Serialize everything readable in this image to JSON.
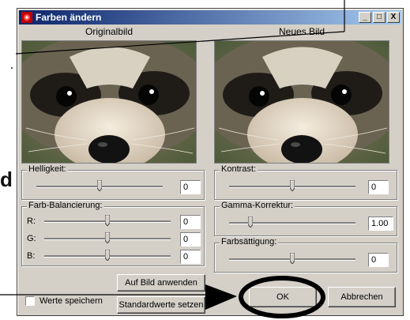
{
  "window": {
    "title": "Farben ändern",
    "controls": {
      "minimize": "_",
      "maximize": "□",
      "close": "X"
    }
  },
  "images": {
    "original_label": "Originalbild",
    "new_label": "Neues Bild"
  },
  "groups": {
    "brightness": {
      "label": "Helligkeit:",
      "value": "0",
      "level": 0.5
    },
    "contrast": {
      "label": "Kontrast:",
      "value": "0",
      "level": 0.5
    },
    "color_balance": {
      "label": "Farb-Balancierung:",
      "rows": [
        {
          "label": "R:",
          "value": "0",
          "level": 0.5
        },
        {
          "label": "G:",
          "value": "0",
          "level": 0.5
        },
        {
          "label": "B:",
          "value": "0",
          "level": 0.5
        }
      ]
    },
    "gamma": {
      "label": "Gamma-Korrektur:",
      "value": "1.00",
      "level": 0.17
    },
    "saturation": {
      "label": "Farbsättigung:",
      "value": "0",
      "level": 0.5
    }
  },
  "buttons": {
    "apply": "Auf Bild anwenden",
    "defaults": "Standardwerte setzen",
    "ok": "OK",
    "cancel": "Abbrechen"
  },
  "checkbox": {
    "label": "Werte speichern",
    "checked": false
  },
  "page": {
    "cut_off_letter": "d"
  },
  "colors": {
    "title_start": "#0a246a",
    "title_end": "#a6caf0",
    "dialog_bg": "#d4d0c8",
    "annotation": "#000000"
  }
}
